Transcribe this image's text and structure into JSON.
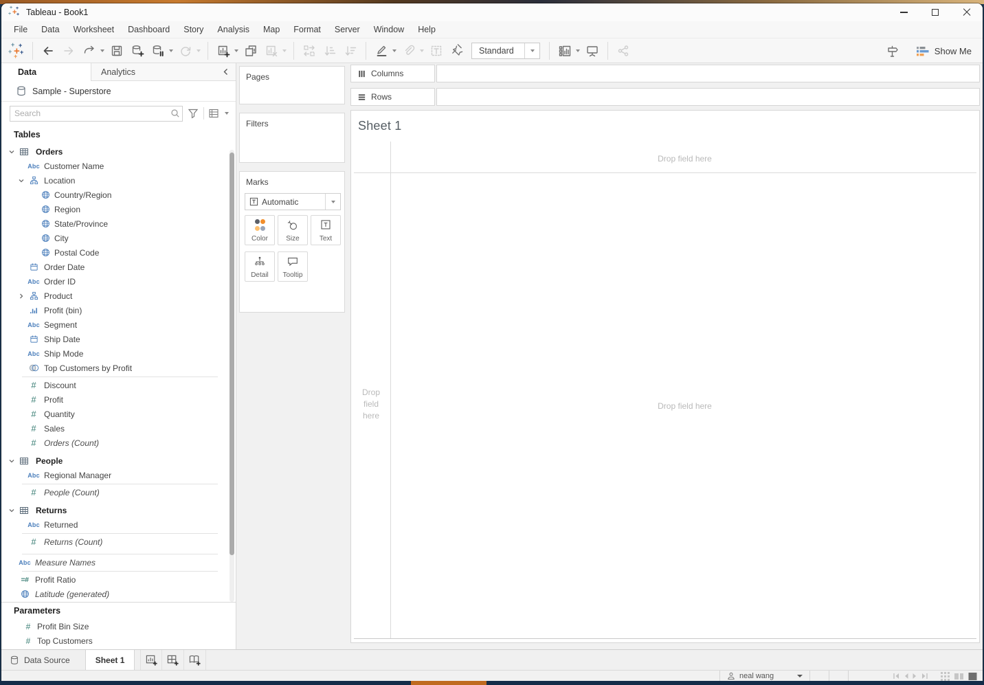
{
  "window": {
    "title": "Tableau - Book1"
  },
  "menu": {
    "items": [
      "File",
      "Data",
      "Worksheet",
      "Dashboard",
      "Story",
      "Analysis",
      "Map",
      "Format",
      "Server",
      "Window",
      "Help"
    ]
  },
  "toolbar": {
    "standard": "Standard",
    "show_me": "Show Me"
  },
  "icons": {
    "abc": "Abc",
    "hash": "#",
    "calc": "=#"
  },
  "pane": {
    "tabs": {
      "data": "Data",
      "analytics": "Analytics"
    },
    "datasource": "Sample - Superstore",
    "search_placeholder": "Search",
    "tables_label": "Tables",
    "fields": [
      "Orders",
      "Customer Name",
      "Location",
      "Country/Region",
      "Region",
      "State/Province",
      "City",
      "Postal Code",
      "Order Date",
      "Order ID",
      "Product",
      "Profit (bin)",
      "Segment",
      "Ship Date",
      "Ship Mode",
      "Top Customers by Profit",
      "Discount",
      "Profit",
      "Quantity",
      "Sales",
      "Orders (Count)",
      "People",
      "Regional Manager",
      "People (Count)",
      "Returns",
      "Returned",
      "Returns (Count)",
      "Measure Names",
      "Profit Ratio",
      "Latitude (generated)"
    ],
    "parameters_label": "Parameters",
    "params": [
      "Profit Bin Size",
      "Top Customers"
    ]
  },
  "cards": {
    "pages": "Pages",
    "filters": "Filters",
    "marks": "Marks",
    "mark_type": "Automatic",
    "color": "Color",
    "size": "Size",
    "text": "Text",
    "detail": "Detail",
    "tooltip": "Tooltip"
  },
  "shelves": {
    "columns": "Columns",
    "rows": "Rows"
  },
  "sheet": {
    "title": "Sheet 1",
    "drop": "Drop field here"
  },
  "tabs": {
    "data_source": "Data Source",
    "sheet": "Sheet 1"
  },
  "status": {
    "user": "neal wang"
  },
  "colors": {
    "field_blue": "#4a7ebb",
    "measure_teal": "#3a7e74",
    "accent_orange": "#f28e2b",
    "showme_blue": "#6b9bd1",
    "desktop_navy": "#1d3753"
  }
}
